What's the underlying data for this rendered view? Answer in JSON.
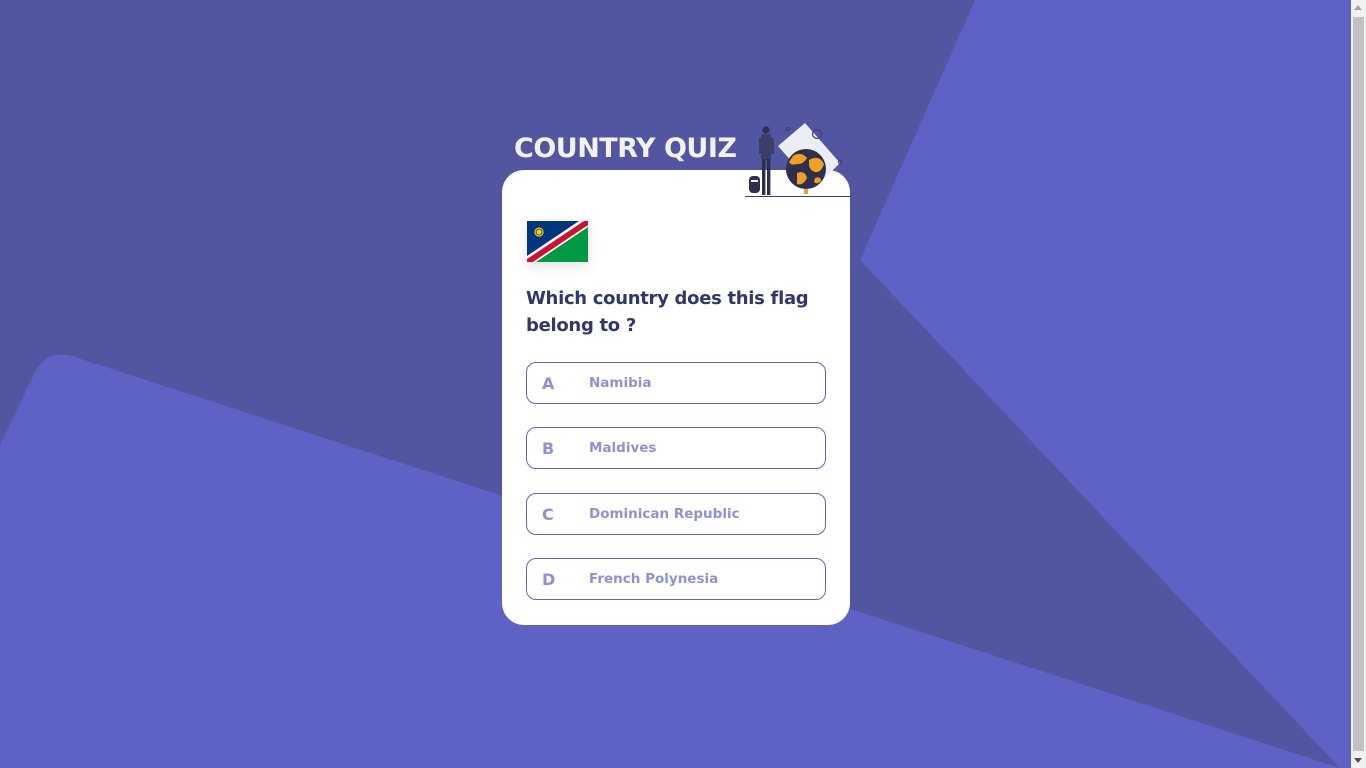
{
  "app": {
    "title": "COUNTRY QUIZ"
  },
  "illustration": {
    "icon": "traveler-globe-illustration"
  },
  "question": {
    "flag_country_icon": "namibia-flag",
    "text": "Which country does this flag belong to ?"
  },
  "options": [
    {
      "letter": "A",
      "text": "Namibia"
    },
    {
      "letter": "B",
      "text": "Maldives"
    },
    {
      "letter": "C",
      "text": "Dominican Republic"
    },
    {
      "letter": "D",
      "text": "French Polynesia"
    }
  ],
  "colors": {
    "background": "#5255a0",
    "background_shape": "#5d62c4",
    "card": "#ffffff",
    "title": "#f2f2f2",
    "question_text": "#2f376b",
    "option_border": "#6066d0",
    "option_text": "#8f91d8"
  }
}
